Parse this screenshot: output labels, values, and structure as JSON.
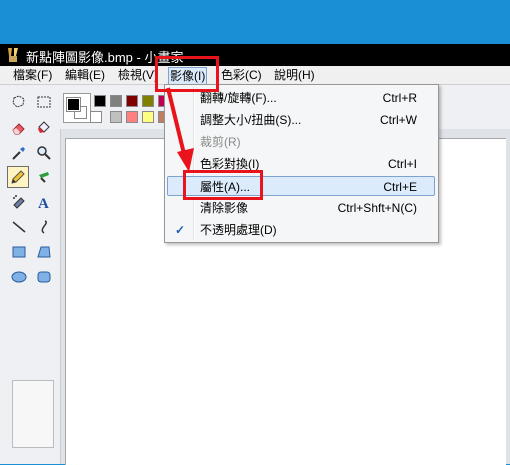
{
  "window": {
    "title": "新點陣圖影像.bmp - 小畫家",
    "app_icon": "paint-icon"
  },
  "menubar": {
    "items": [
      "檔案(F)",
      "編輯(E)",
      "檢視(V)",
      "影像(I)",
      "色彩(C)",
      "說明(H)"
    ],
    "active": "影像(I)"
  },
  "image_menu": {
    "items": [
      {
        "label": "翻轉/旋轉(F)...",
        "shortcut": "Ctrl+R",
        "enabled": true
      },
      {
        "label": "調整大小/扭曲(S)...",
        "shortcut": "Ctrl+W",
        "enabled": true
      },
      {
        "label": "裁剪(R)",
        "shortcut": "",
        "enabled": false
      },
      {
        "label": "色彩對換(I)",
        "shortcut": "Ctrl+I",
        "enabled": true
      },
      {
        "label": "屬性(A)...",
        "shortcut": "Ctrl+E",
        "enabled": true,
        "highlighted": true
      },
      {
        "label": "清除影像",
        "shortcut": "Ctrl+Shft+N(C)",
        "enabled": true
      },
      {
        "label": "不透明處理(D)",
        "shortcut": "",
        "enabled": true,
        "checked": true
      }
    ]
  },
  "toolbox": {
    "tools": [
      "free-select-icon",
      "rect-select-icon",
      "eraser-icon",
      "fill-bucket-icon",
      "color-picker-icon",
      "magnifier-icon",
      "pencil-icon",
      "brush-icon",
      "airbrush-icon",
      "text-icon",
      "line-icon",
      "curve-icon",
      "rectangle-icon",
      "polygon-icon",
      "ellipse-icon",
      "rounded-rect-icon"
    ],
    "selected": "pencil-icon"
  },
  "palette": {
    "foreground": "#000000",
    "background": "#ffffff",
    "top_row": [
      "#000000",
      "#808080",
      "#800000",
      "#808000",
      "#c00050",
      "#e8132b"
    ],
    "bottom_row": [
      "#ffffff",
      "#c0c0c0",
      "#ff8080",
      "#ffff80",
      "#c08060",
      "#ffc8c8"
    ]
  },
  "annotation": {
    "color": "#e8131b"
  }
}
